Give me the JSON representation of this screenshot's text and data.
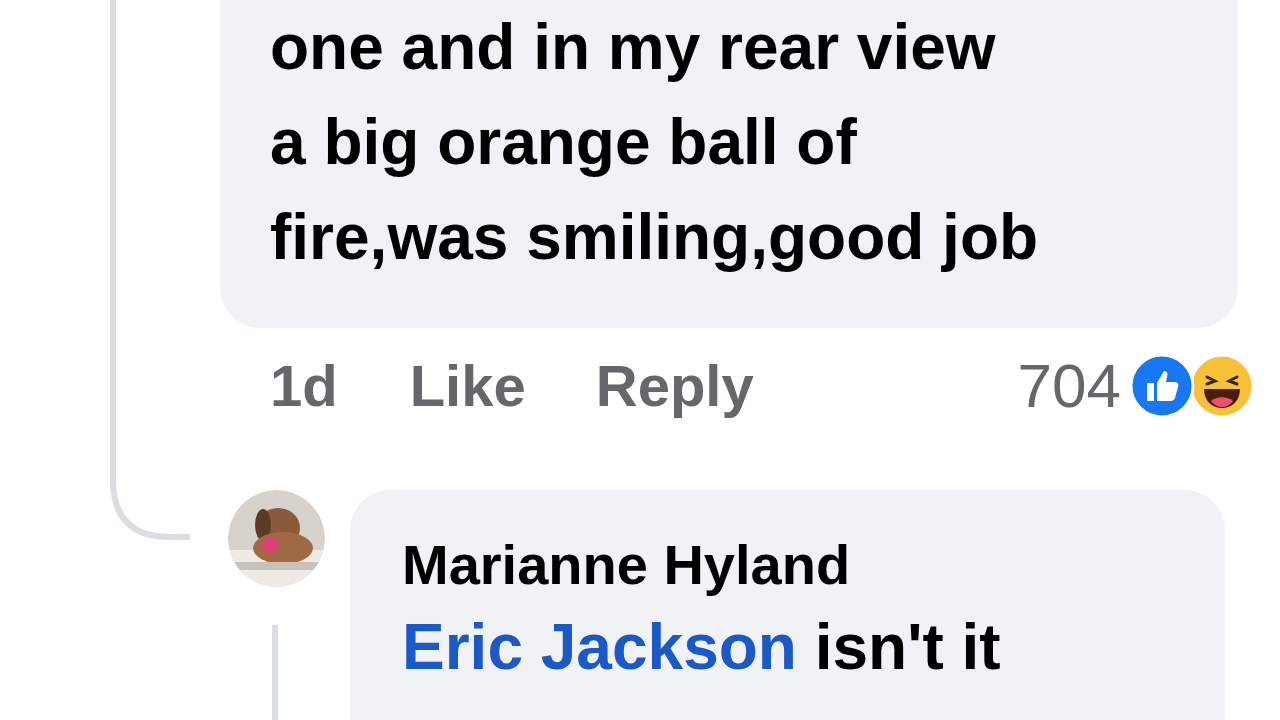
{
  "comment": {
    "text_lines": [
      "one and in my rear view",
      "a big orange ball of",
      "fire,was smiling,good job"
    ],
    "time": "1d",
    "actions": [
      "Like",
      "Reply"
    ],
    "reaction_count": "704",
    "reactions": [
      {
        "kind": "like"
      },
      {
        "kind": "haha"
      }
    ]
  },
  "reply": {
    "author": "Marianne Hyland",
    "mention": "Eric Jackson",
    "text": "isn't it"
  }
}
